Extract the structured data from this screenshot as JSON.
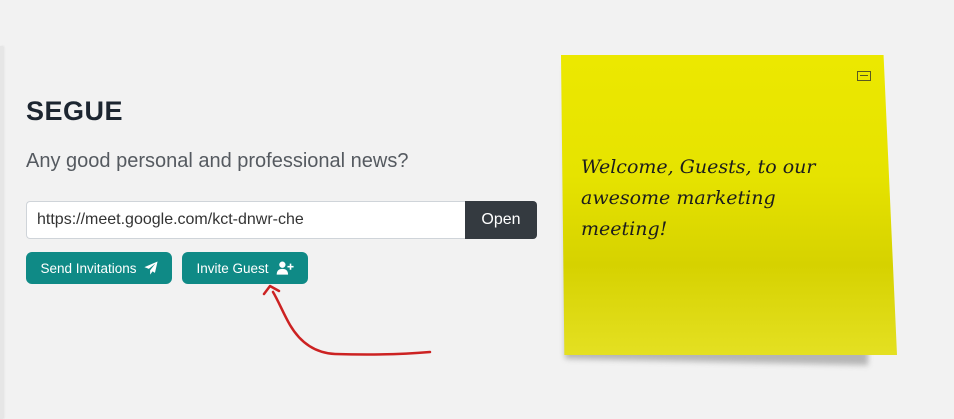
{
  "section": {
    "title": "SEGUE",
    "prompt": "Any good personal and professional news?"
  },
  "meeting": {
    "url": "https://meet.google.com/kct-dnwr-che",
    "open_label": "Open"
  },
  "actions": {
    "send_invitations_label": "Send Invitations",
    "invite_guest_label": "Invite Guest"
  },
  "sticky_note": {
    "text": "Welcome, Guests, to our awesome marketing meeting!",
    "color": "#e6e300"
  },
  "colors": {
    "accent": "#0f8a86",
    "open_button": "#343a40",
    "annotation_arrow": "#cc2222"
  },
  "icons": {
    "send": "paper-plane-icon",
    "invite": "user-plus-icon",
    "minimize": "minimize-icon"
  }
}
